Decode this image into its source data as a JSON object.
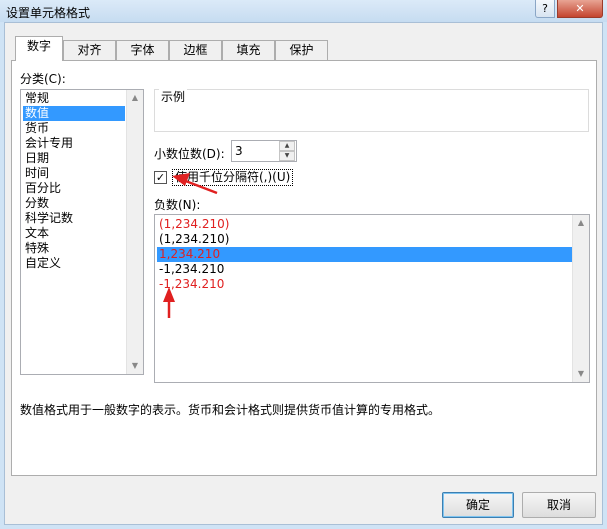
{
  "window": {
    "title": "设置单元格格式",
    "help_glyph": "?",
    "close_glyph": "✕"
  },
  "tabs": [
    {
      "label": "数字",
      "active": true
    },
    {
      "label": "对齐"
    },
    {
      "label": "字体"
    },
    {
      "label": "边框"
    },
    {
      "label": "填充"
    },
    {
      "label": "保护"
    }
  ],
  "category": {
    "label": "分类(C):",
    "items": [
      "常规",
      "数值",
      "货币",
      "会计专用",
      "日期",
      "时间",
      "百分比",
      "分数",
      "科学记数",
      "文本",
      "特殊",
      "自定义"
    ],
    "selected": "数值"
  },
  "sample": {
    "label": "示例"
  },
  "decimal": {
    "label": "小数位数(D):",
    "value": "3"
  },
  "thousands": {
    "label": "使用千位分隔符(,)(U)",
    "checked": true
  },
  "negative": {
    "label": "负数(N):",
    "items": [
      {
        "text": "(1,234.210)",
        "color": "#e02020"
      },
      {
        "text": "(1,234.210)",
        "color": "#000000"
      },
      {
        "text": "1,234.210",
        "color": "#e02020",
        "selected": true
      },
      {
        "text": "-1,234.210",
        "color": "#000000"
      },
      {
        "text": "-1,234.210",
        "color": "#e02020"
      }
    ]
  },
  "description": "数值格式用于一般数字的表示。货币和会计格式则提供货币值计算的专用格式。",
  "buttons": {
    "ok": "确定",
    "cancel": "取消"
  },
  "colors": {
    "selection": "#3399ff",
    "annotation_arrow": "#e02020"
  }
}
